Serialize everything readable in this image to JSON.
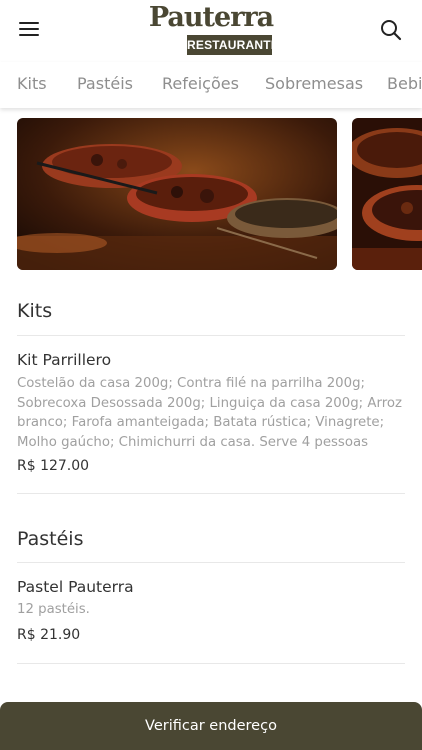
{
  "header": {
    "logo_line1": "Pauterra",
    "logo_line2": "RESTAURANTE",
    "menu_icon": "hamburger-menu-icon",
    "search_icon": "search-icon"
  },
  "tabs": [
    "Kits",
    "Pastéis",
    "Refeições",
    "Sobremesas",
    "Bebi"
  ],
  "sections": [
    {
      "title": "Kits",
      "items": [
        {
          "name": "Kit Parrillero",
          "description": "Costelão da casa 200g; Contra filé na parrilha 200g; Sobrecoxa Desossada 200g; Linguiça da casa 200g; Arroz branco; Farofa amanteigada; Batata rústica; Vinagrete; Molho gaúcho; Chimichurri da casa. Serve 4 pessoas",
          "price": "R$ 127.00"
        }
      ]
    },
    {
      "title": "Pastéis",
      "items": [
        {
          "name": "Pastel Pauterra",
          "description": "12 pastéis.",
          "price": "R$ 21.90"
        }
      ]
    }
  ],
  "footer": {
    "button_label": "Verificar endereço"
  },
  "colors": {
    "brand": "#4a4733",
    "muted_text": "#a0a0a0"
  }
}
